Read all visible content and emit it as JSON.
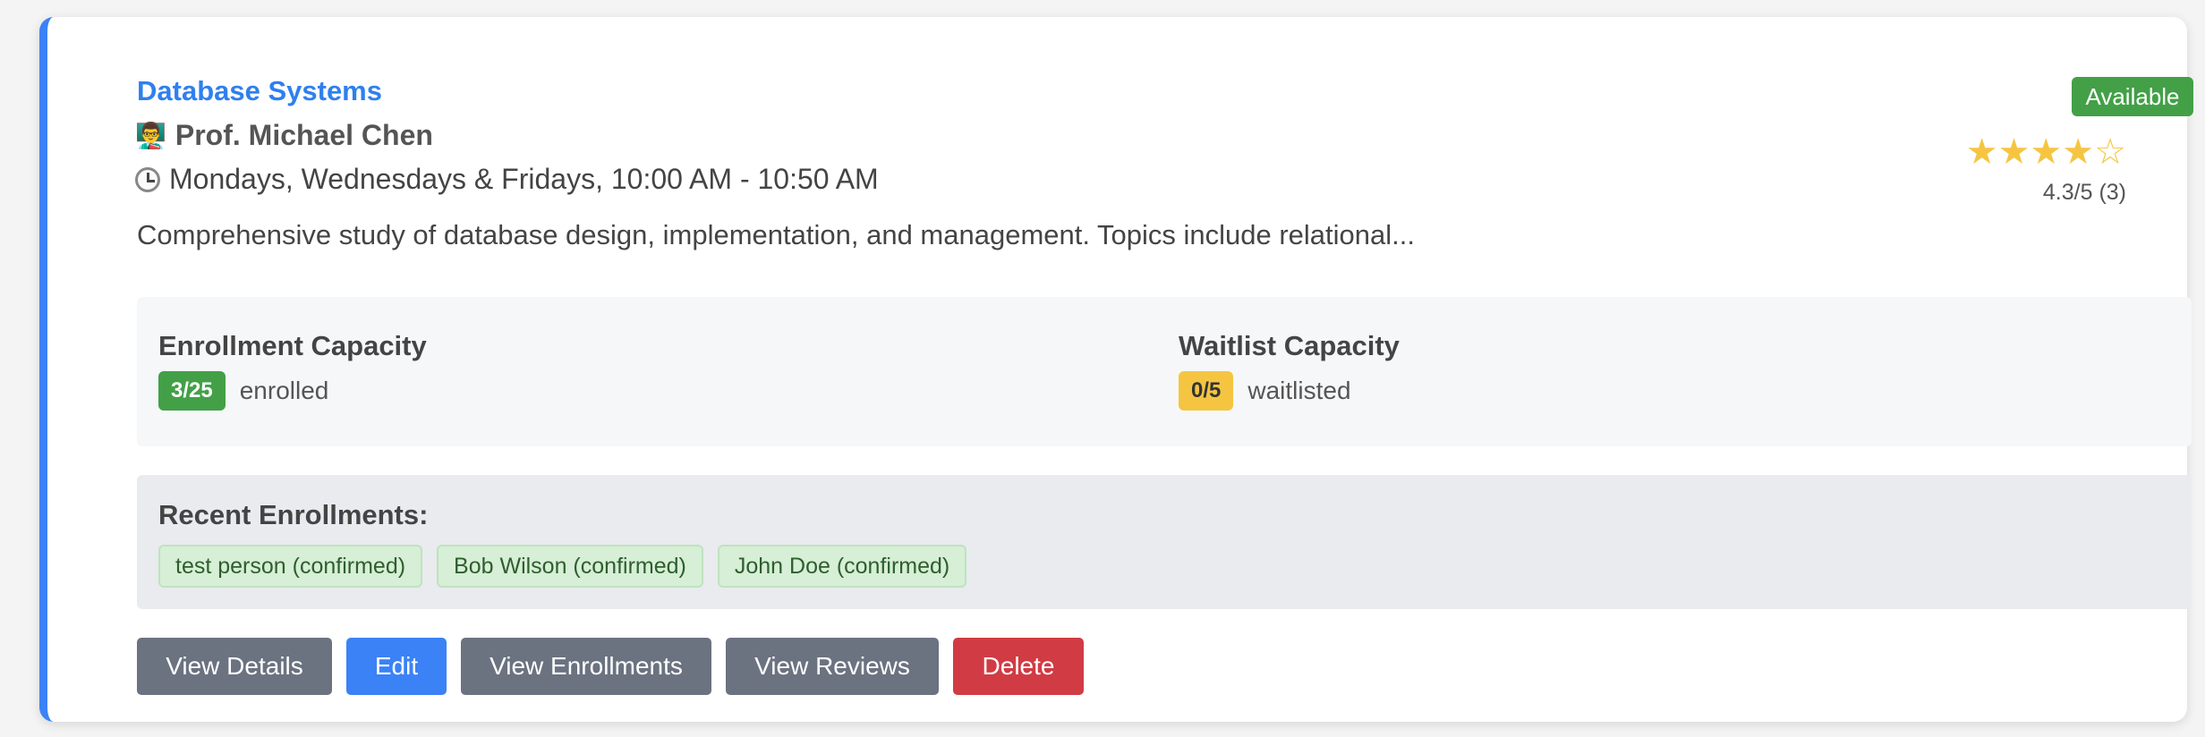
{
  "course": {
    "title": "Database Systems",
    "instructor_icon": "👨‍🏫",
    "instructor": "Prof. Michael Chen",
    "schedule_icon": "clock-icon",
    "schedule": "Mondays, Wednesdays & Fridays, 10:00 AM - 10:50 AM",
    "description": "Comprehensive study of database design, implementation, and management. Topics include relational..."
  },
  "status": {
    "label": "Available",
    "color": "#43a047"
  },
  "rating": {
    "stars": "★★★★☆",
    "text": "4.3/5 (3)",
    "value": 4.3,
    "max": 5,
    "count": 3
  },
  "enrollment": {
    "title": "Enrollment Capacity",
    "badge": "3/25",
    "suffix": "enrolled",
    "color": "#43a047"
  },
  "waitlist": {
    "title": "Waitlist Capacity",
    "badge": "0/5",
    "suffix": "waitlisted",
    "color": "#f5c542"
  },
  "recent": {
    "title": "Recent Enrollments:",
    "items": [
      "test person (confirmed)",
      "Bob Wilson (confirmed)",
      "John Doe (confirmed)"
    ]
  },
  "actions": {
    "view_details": "View Details",
    "edit": "Edit",
    "view_enrollments": "View Enrollments",
    "view_reviews": "View Reviews",
    "delete": "Delete"
  },
  "colors": {
    "accent": "#3b82f6",
    "danger": "#d13b44",
    "secondary": "#6b7280"
  }
}
